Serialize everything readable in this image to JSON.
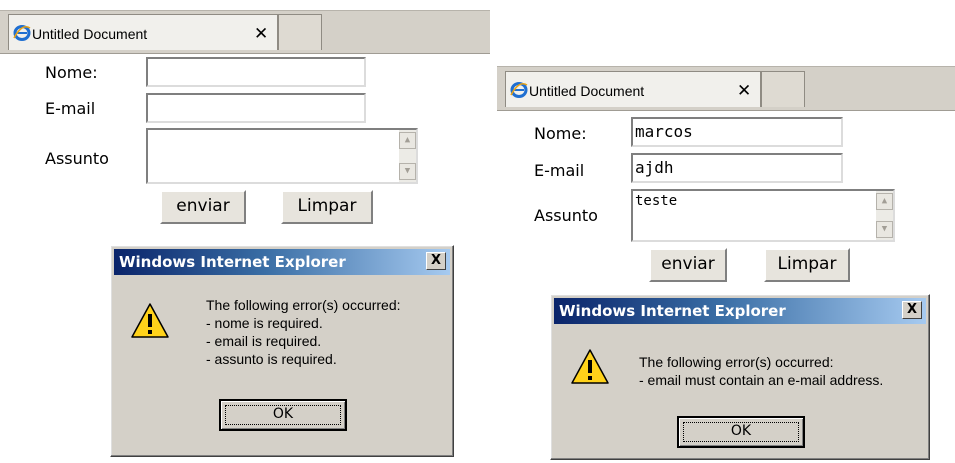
{
  "windows": [
    {
      "tab": {
        "title": "Untitled Document",
        "close": "✕"
      },
      "form": {
        "nome_label": "Nome:",
        "nome_value": "",
        "email_label": "E-mail",
        "email_value": "",
        "assunto_label": "Assunto",
        "assunto_value": "",
        "enviar_label": "enviar",
        "limpar_label": "Limpar"
      },
      "dialog": {
        "title": "Windows Internet Explorer",
        "close": "X",
        "lines": [
          "The following error(s) occurred:",
          "- nome is required.",
          "- email is required.",
          "- assunto is required."
        ],
        "ok_label": "OK"
      }
    },
    {
      "tab": {
        "title": "Untitled Document",
        "close": "✕"
      },
      "form": {
        "nome_label": "Nome:",
        "nome_value": "marcos",
        "email_label": "E-mail",
        "email_value": "ajdh",
        "assunto_label": "Assunto",
        "assunto_value": "teste",
        "enviar_label": "enviar",
        "limpar_label": "Limpar"
      },
      "dialog": {
        "title": "Windows Internet Explorer",
        "close": "X",
        "lines": [
          "The following error(s) occurred:",
          "- email must contain an e-mail address."
        ],
        "ok_label": "OK"
      }
    }
  ],
  "icons": {
    "browser": "internet-explorer-icon",
    "warning": "warning-icon"
  },
  "colors": {
    "titlebar_start": "#0a246a",
    "titlebar_end": "#a6caf0",
    "dialog_bg": "#d4d0c8",
    "warning_yellow": "#ffd21a"
  }
}
